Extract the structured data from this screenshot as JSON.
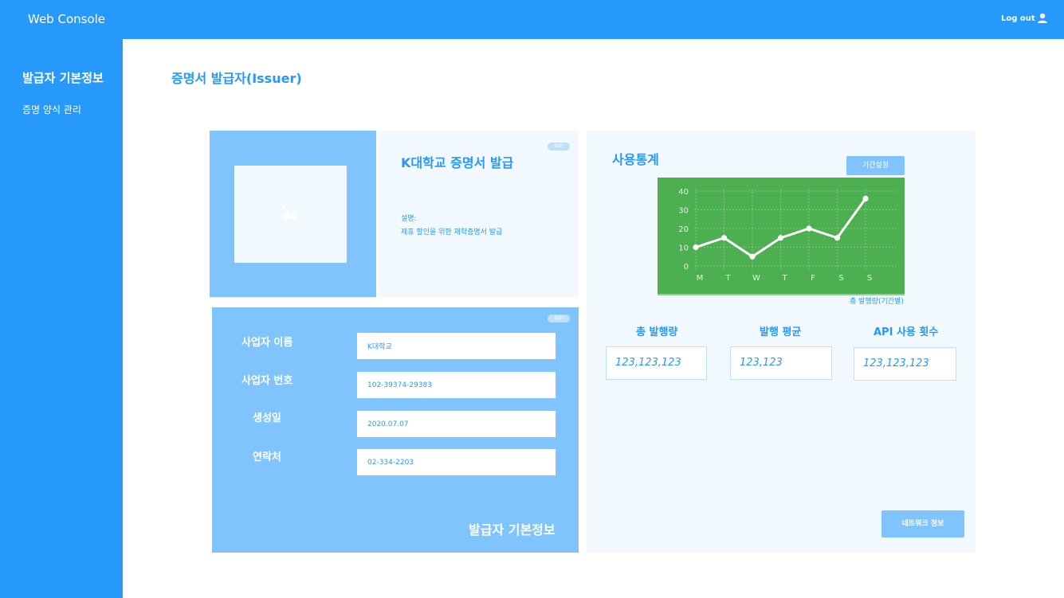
{
  "header": {
    "app_title": "Web Console",
    "logout_label": "Log out"
  },
  "sidebar": {
    "items": [
      {
        "label": "발급자 기본정보"
      },
      {
        "label": "증명 양식 관리"
      }
    ]
  },
  "page": {
    "title": "증명서 발급자(Issuer)"
  },
  "certificate": {
    "edit_label": "Edit",
    "title": "K대학교 증명서 발급",
    "description_label": "설명:",
    "description": "제휴 할인을 위한 재학증명서 발급"
  },
  "issuer_info": {
    "edit_label": "Edit",
    "fields": [
      {
        "label": "사업자 이름",
        "value": "K대학교"
      },
      {
        "label": "사업자 번호",
        "value": "102-39374-29383"
      },
      {
        "label": "생성일",
        "value": "2020.07.07"
      },
      {
        "label": "연락처",
        "value": "02-334-2203"
      }
    ],
    "footer_title": "발급자 기본정보"
  },
  "stats": {
    "title": "사용통계",
    "period_button": "기간설정",
    "chart_caption": "총 발행량(기간별)",
    "total_label": "총 발행량",
    "total_value": "123,123,123",
    "avg_label": "발행 평균",
    "avg_value": "123,123",
    "api_label": "API 사용 횟수",
    "api_value": "123,123,123",
    "network_button": "네트워크 정보"
  },
  "chart_data": {
    "type": "line",
    "categories": [
      "M",
      "T",
      "W",
      "T",
      "F",
      "S",
      "S"
    ],
    "series": [
      {
        "values": [
          10,
          15,
          5,
          15,
          20,
          15,
          36
        ]
      }
    ],
    "yticks": [
      0,
      10,
      20,
      30,
      40
    ],
    "ylim": [
      0,
      40
    ],
    "grid": true,
    "colors": {
      "background": "#4caf50",
      "line": "#ffffff"
    }
  },
  "colors": {
    "primary": "#2699fb",
    "light": "#7fc4fd",
    "pale": "#f1f9ff",
    "border": "#bce0fd",
    "chart": "#4caf50"
  }
}
